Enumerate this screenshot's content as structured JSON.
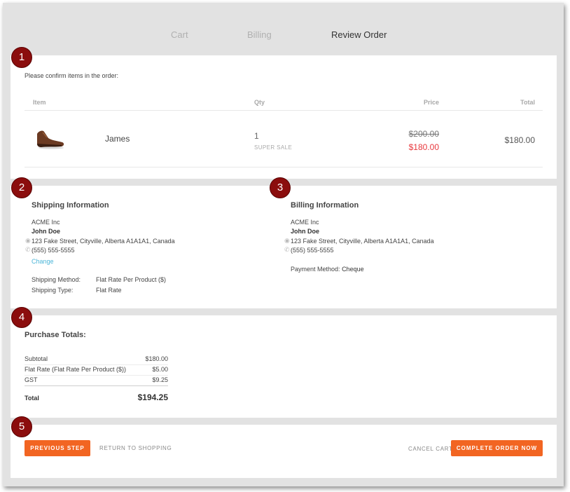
{
  "steps": {
    "cart": "Cart",
    "billing": "Billing",
    "review": "Review Order"
  },
  "badges": [
    "1",
    "2",
    "3",
    "4",
    "5"
  ],
  "items": {
    "prompt": "Please confirm items in the order:",
    "headers": {
      "item": "Item",
      "qty": "Qty",
      "price": "Price",
      "total": "Total"
    },
    "row": {
      "name": "James",
      "qty": "1",
      "qty_note": "SUPER SALE",
      "old_price": "$200.00",
      "sale_price": "$180.00",
      "total": "$180.00"
    }
  },
  "shipping": {
    "title": "Shipping Information",
    "company": "ACME Inc",
    "name": "John Doe",
    "address": "123 Fake Street, Cityville, Alberta A1A1A1, Canada",
    "phone": "(555) 555-5555",
    "change": "Change",
    "method_label": "Shipping Method:",
    "method_value": "Flat Rate Per Product ($)",
    "type_label": "Shipping Type:",
    "type_value": "Flat Rate"
  },
  "billing": {
    "title": "Billing Information",
    "company": "ACME Inc",
    "name": "John Doe",
    "address": "123 Fake Street, Cityville, Alberta A1A1A1, Canada",
    "phone": "(555) 555-5555",
    "payment_label": "Payment Method:",
    "payment_value": "Cheque"
  },
  "totals": {
    "title": "Purchase Totals:",
    "subtotal_label": "Subtotal",
    "subtotal_value": "$180.00",
    "flat_label": "Flat Rate (Flat Rate Per Product ($))",
    "flat_value": "$5.00",
    "gst_label": "GST",
    "gst_value": "$9.25",
    "total_label": "Total",
    "total_value": "$194.25"
  },
  "actions": {
    "previous": "PREVIOUS STEP",
    "return": "RETURN TO SHOPPING",
    "cancel": "CANCEL CART",
    "complete": "COMPLETE ORDER NOW"
  },
  "colors": {
    "accent": "#f26522",
    "badge": "#8b0d0d",
    "sale": "#e8383d"
  }
}
